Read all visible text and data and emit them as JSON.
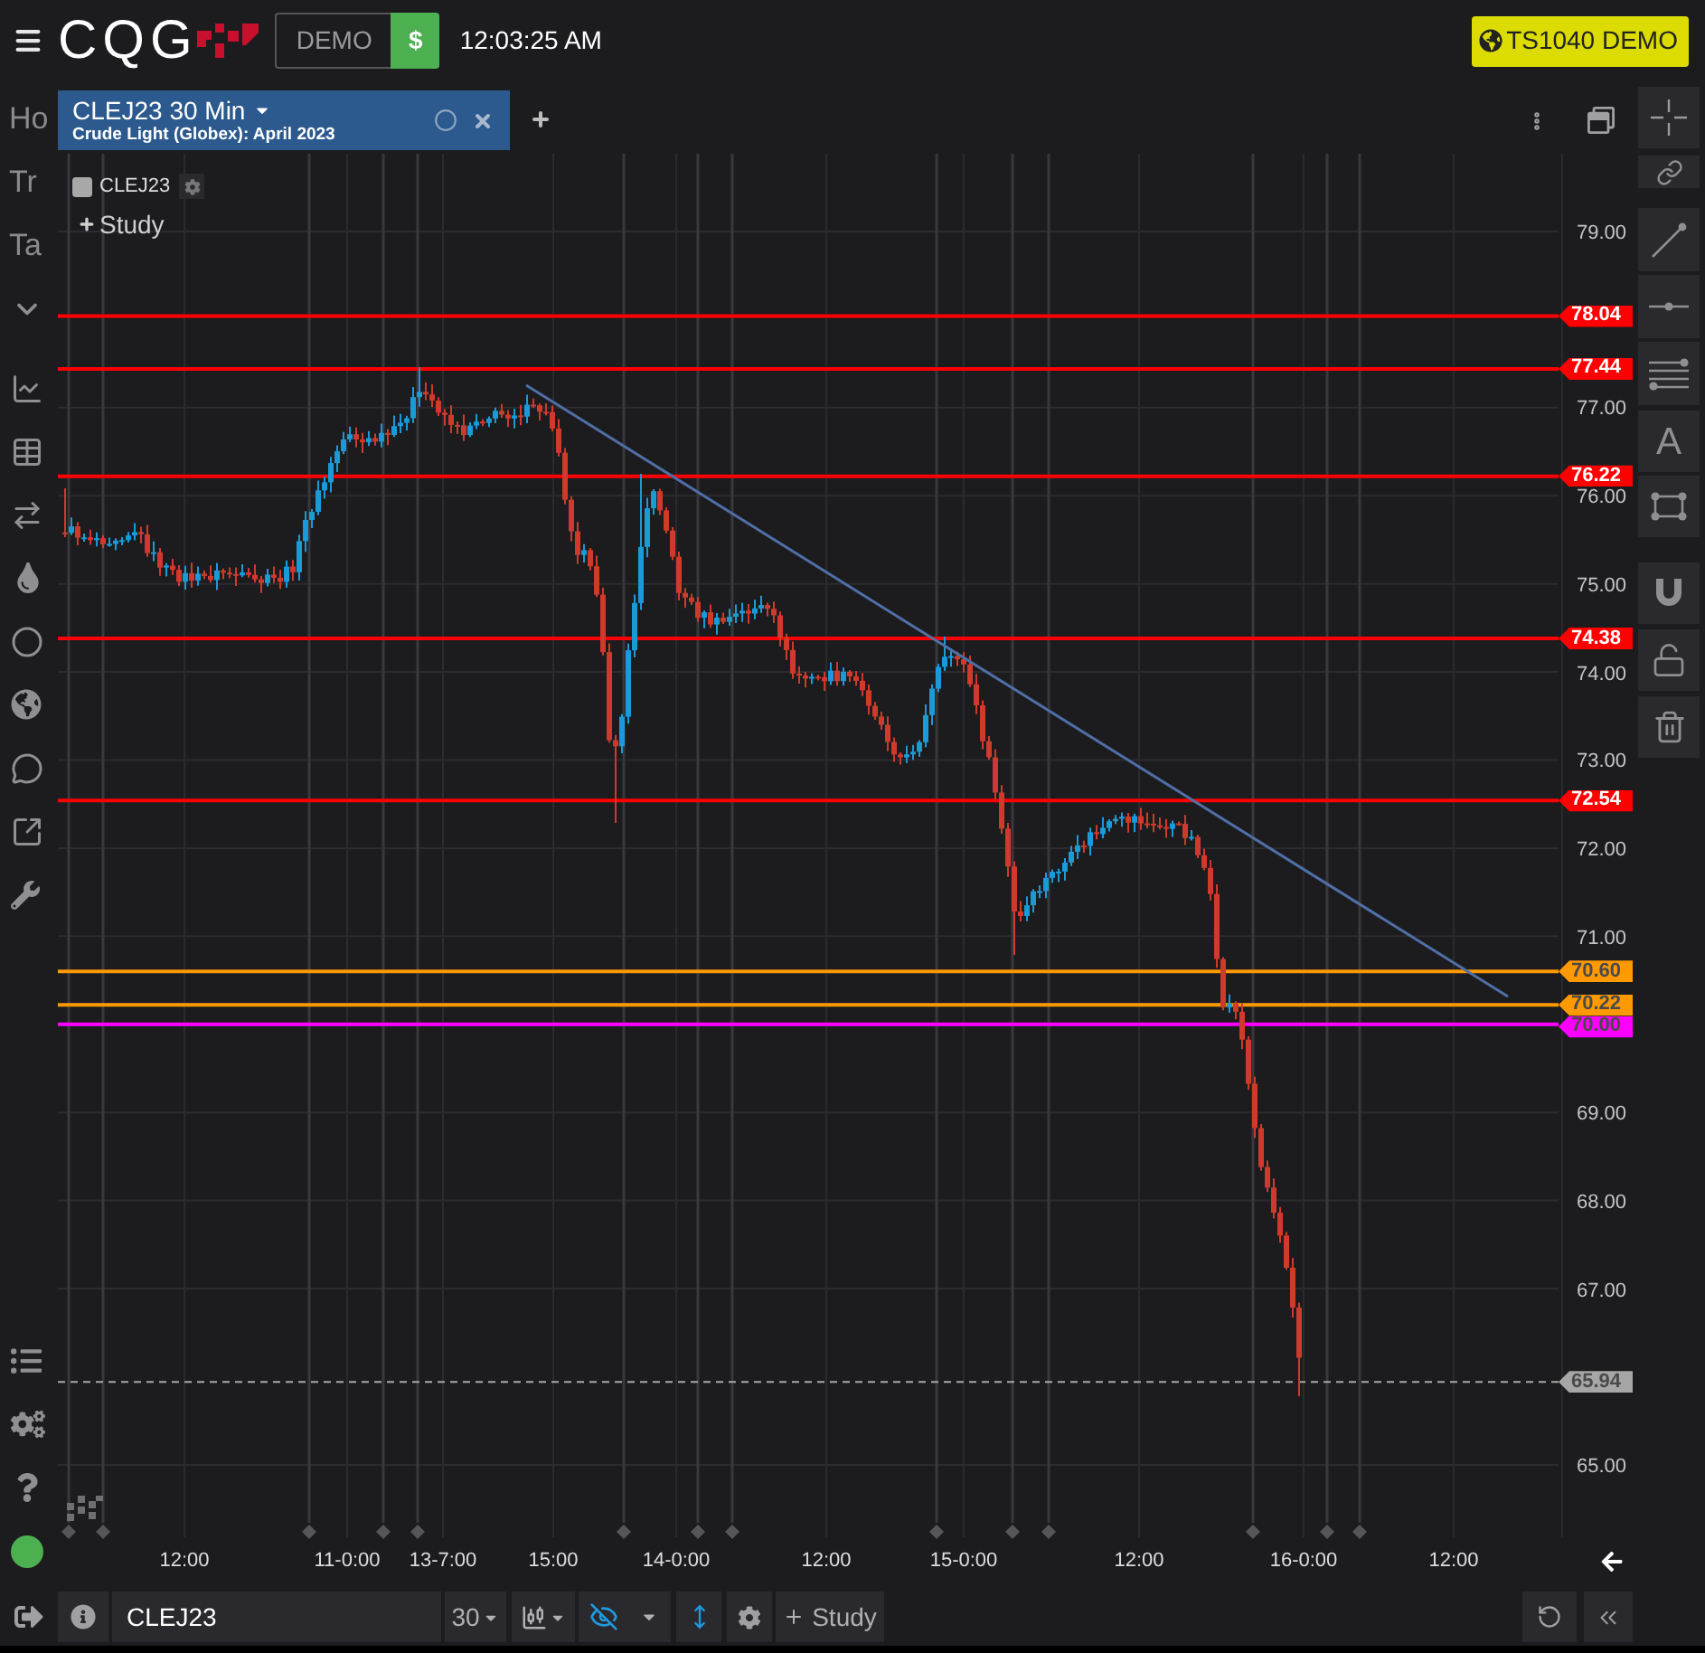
{
  "header": {
    "brand": "CQG",
    "mode": "DEMO",
    "currency": "$",
    "time": "12:03:25 AM",
    "account": "TS1040 DEMO"
  },
  "sidebar": {
    "items": [
      {
        "label": "Ho"
      },
      {
        "label": "Tr"
      },
      {
        "label": "Ta"
      }
    ]
  },
  "tabs": [
    {
      "title": "CLEJ23 30 Min",
      "subtitle": "Crude Light (Globex): April 2023",
      "selected": true
    }
  ],
  "drawing_tools": {
    "text_tool": "A"
  },
  "legend": {
    "symbol": "CLEJ23",
    "study_button": "Study"
  },
  "price_axis": {
    "ticks": [
      "79.00",
      "77.00",
      "76.00",
      "75.00",
      "74.00",
      "73.00",
      "72.00",
      "71.00",
      "69.00",
      "68.00",
      "67.00",
      "65.00"
    ]
  },
  "levels": [
    {
      "label": "78.04",
      "color": "#ff0000",
      "kind": "line"
    },
    {
      "label": "77.44",
      "color": "#ff0000",
      "kind": "line"
    },
    {
      "label": "76.22",
      "color": "#ff0000",
      "kind": "line"
    },
    {
      "label": "74.38",
      "color": "#ff0000",
      "kind": "line"
    },
    {
      "label": "72.54",
      "color": "#ff0000",
      "kind": "line"
    },
    {
      "label": "70.60",
      "color": "#ff9900",
      "kind": "line"
    },
    {
      "label": "70.22",
      "color": "#ff9900",
      "kind": "line"
    },
    {
      "label": "70.00",
      "color": "#ff00ff",
      "kind": "line"
    },
    {
      "label": "65.94",
      "color": "#a6a6a6",
      "kind": "last"
    }
  ],
  "time_axis": {
    "labels": [
      "12:00",
      "11-0:00",
      "13-7:00",
      "15:00",
      "14-0:00",
      "12:00",
      "15-0:00",
      "12:00",
      "16-0:00",
      "12:00"
    ]
  },
  "bottom_bar": {
    "symbol": "CLEJ23",
    "interval": "30",
    "study_button": "Study"
  }
}
